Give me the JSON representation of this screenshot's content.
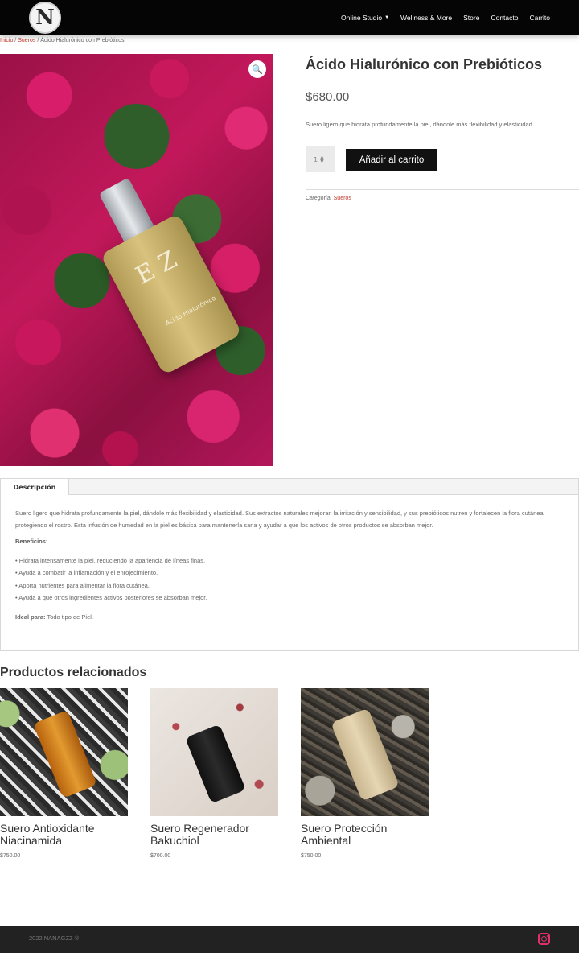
{
  "header": {
    "logo_letter": "N",
    "nav": [
      {
        "label": "Online Studio",
        "has_dropdown": true
      },
      {
        "label": "Wellness & More"
      },
      {
        "label": "Store"
      },
      {
        "label": "Contacto"
      },
      {
        "label": "Carrito"
      }
    ]
  },
  "breadcrumb": {
    "home": "Inicio",
    "sep1": " / ",
    "category": "Sueros",
    "sep2": " / ",
    "current": "Ácido Hialurónico con Prebióticos"
  },
  "product": {
    "title": "Ácido Hialurónico con Prebióticos",
    "price": "$680.00",
    "short_description": "Suero ligero que hidrata profundamente la piel, dándole más flexibilidad y elasticidad.",
    "quantity": "1",
    "add_to_cart": "Añadir al carrito",
    "category_label": "Categoría: ",
    "category": "Sueros",
    "bottle_monogram": "E Z",
    "bottle_text": "Ácido Hialurónico"
  },
  "tabs": {
    "active_tab": "Descripción",
    "intro": "Suero ligero que hidrata profundamente la piel, dándole más flexibilidad y elasticidad. Sus extractos naturales mejoran la irritación y sensibilidad, y sus prebióticos nutren y fortalecen la flora cutánea, protegiendo el rostro. Esta infusión de humedad en la piel es básica para mantenerla sana y ayudar a que los activos de otros productos se absorban mejor.",
    "benefits_heading": "Beneficios:",
    "benefits": [
      "Hidrata intensamente la piel, reduciendo la apariencia de líneas finas.",
      "Ayuda a combatir la inflamación y el enrojecimiento.",
      "Aporta nutrientes para alimentar la flora cutánea.",
      "Ayuda a que otros ingredientes activos posteriores se absorban mejor."
    ],
    "ideal_label": "Ideal para:",
    "ideal_value": " Todo tipo de Piel."
  },
  "related": {
    "heading": "Productos relacionados",
    "items": [
      {
        "name": "Suero Antioxidante Niacinamida",
        "price": "$750.00"
      },
      {
        "name": "Suero Regenerador Bakuchiol",
        "price": "$700.00"
      },
      {
        "name": "Suero Protección Ambiental",
        "price": "$750.00"
      }
    ]
  },
  "footer": {
    "copyright": "2022 NANAGZZ ®",
    "social_icon": "instagram-icon"
  },
  "colors": {
    "header_bg": "#050505",
    "link": "#c0392b",
    "button_bg": "#111111",
    "footer_bg": "#222222",
    "instagram": "#e1306c"
  }
}
